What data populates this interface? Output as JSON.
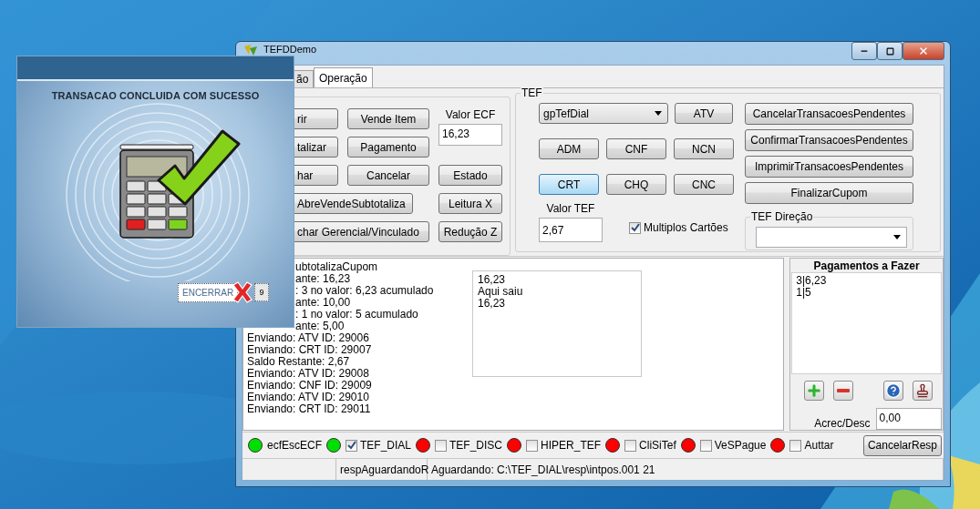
{
  "popup": {
    "message": "TRANSACAO CONCLUIDA COM SUCESSO",
    "close_button": "ENCERRAR",
    "countdown": "9"
  },
  "window": {
    "title": "TEFDDemo"
  },
  "tabs": [
    {
      "label": "ão",
      "selected": false,
      "clipped": true
    },
    {
      "label": "Operação",
      "selected": true,
      "clipped": false
    }
  ],
  "ecf": {
    "buttons": [
      {
        "label": "rir",
        "clipped": true
      },
      {
        "label": "Vende Item",
        "clipped": false
      },
      {
        "label": "talizar",
        "clipped": true
      },
      {
        "label": "Pagamento",
        "clipped": false
      },
      {
        "label": "har",
        "clipped": true
      },
      {
        "label": "Cancelar",
        "clipped": false
      },
      {
        "label": "Estado",
        "clipped": false
      },
      {
        "label": "AbreVendeSubtotaliza",
        "clipped": true
      },
      {
        "label": "Leitura X",
        "clipped": false
      },
      {
        "label": "char Gerencial/Vinculado",
        "clipped": true
      },
      {
        "label": "Redução Z",
        "clipped": false
      }
    ],
    "value_label": "Valor ECF",
    "value": "16,23"
  },
  "tef": {
    "legend": "TEF",
    "gateway": "gpTefDial",
    "buttons": [
      {
        "label": "ATV",
        "focused": false
      },
      {
        "label": "ADM",
        "focused": false
      },
      {
        "label": "CNF",
        "focused": false
      },
      {
        "label": "NCN",
        "focused": false
      },
      {
        "label": "CRT",
        "focused": true
      },
      {
        "label": "CHQ",
        "focused": false
      },
      {
        "label": "CNC",
        "focused": false
      }
    ],
    "value_label": "Valor TEF",
    "value": "2,67",
    "multiple_cards": {
      "label": "Multiplos Cartões",
      "checked": true
    },
    "actions": [
      "CancelarTransacoesPendentes",
      "ConfirmarTransacoesPendentes",
      "ImprimirTransacoesPendentes",
      "FinalizarCupom"
    ],
    "direction_legend": "TEF Direção"
  },
  "log": {
    "lines": [
      {
        "text": "ubtotalizaCupom",
        "clipped": true
      },
      {
        "text": "ante: 16,23",
        "clipped": true
      },
      {
        "text": ": 3 no valor: 6,23 acumulado",
        "clipped": true
      },
      {
        "text": "ante: 10,00",
        "clipped": true
      },
      {
        "text": ": 1 no valor: 5 acumulado",
        "clipped": true
      },
      {
        "text": "ante: 5,00",
        "clipped": true
      },
      {
        "text": "Enviando: ATV ID: 29006"
      },
      {
        "text": "Enviando: CRT ID: 29007"
      },
      {
        "text": "Saldo Restante: 2,67"
      },
      {
        "text": "Enviando: ATV ID: 29008"
      },
      {
        "text": "Enviando: CNF ID: 29009"
      },
      {
        "text": "Enviando: ATV ID: 29010"
      },
      {
        "text": "Enviando: CRT ID: 29011"
      }
    ],
    "memo": [
      "16,23",
      "Aqui saiu",
      "16,23"
    ]
  },
  "payments": {
    "title": "Pagamentos a Fazer",
    "items": [
      "3|6,23",
      "1|5"
    ],
    "adjust_label": "Acrec/Desc",
    "adjust_value": "0,00"
  },
  "indicators": [
    {
      "kind": "led",
      "label": "ecfEscECF",
      "color": "#00e000"
    },
    {
      "kind": "led-check",
      "label": "TEF_DIAL",
      "color": "#00e000",
      "checked": true
    },
    {
      "kind": "led-check",
      "label": "TEF_DISC",
      "color": "#ff0000",
      "checked": false
    },
    {
      "kind": "led-check",
      "label": "HIPER_TEF",
      "color": "#ff0000",
      "checked": false
    },
    {
      "kind": "led-check",
      "label": "CliSiTef",
      "color": "#ff0000",
      "checked": false
    },
    {
      "kind": "led-check",
      "label": "VeSPague",
      "color": "#ff0000",
      "checked": false
    },
    {
      "kind": "led-check",
      "label": "Auttar",
      "color": "#ff0000",
      "checked": false
    }
  ],
  "cancel_response": "CancelarResp",
  "status_bar": [
    "respAguardandoR",
    "Aguardando: C:\\TEF_DIAL\\resp\\intpos.001 21"
  ]
}
